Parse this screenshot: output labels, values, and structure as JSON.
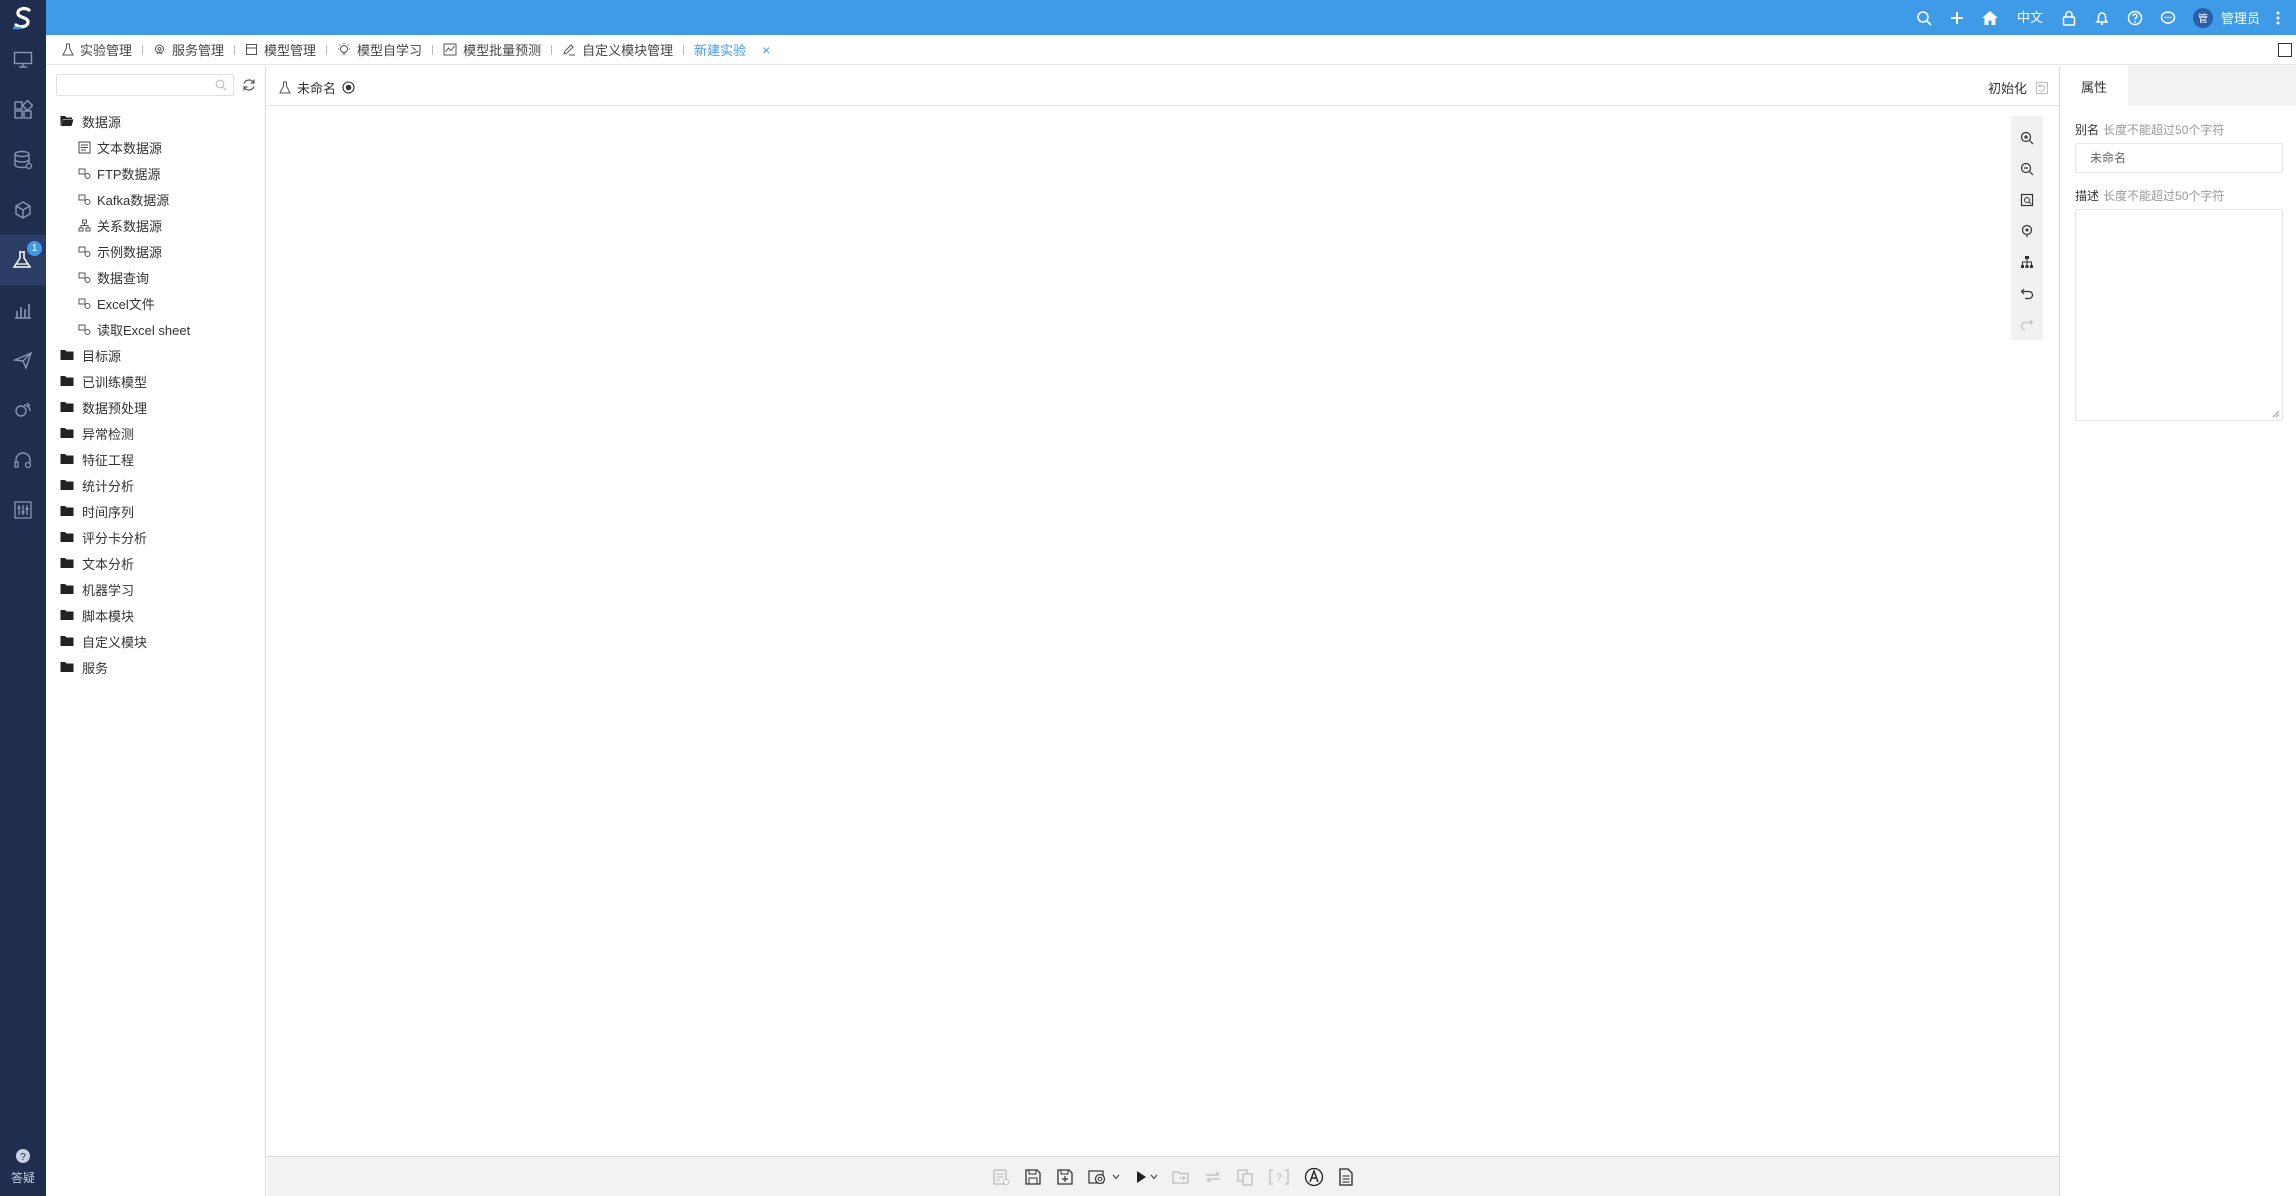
{
  "header": {
    "language": "中文",
    "user_name": "管理员",
    "avatar_text": "管"
  },
  "nav": {
    "badge": "1",
    "help_label": "答疑"
  },
  "tabs": [
    {
      "label": "实验管理"
    },
    {
      "label": "服务管理"
    },
    {
      "label": "模型管理"
    },
    {
      "label": "模型自学习"
    },
    {
      "label": "模型批量预测"
    },
    {
      "label": "自定义模块管理"
    },
    {
      "label": "新建实验",
      "active": true
    }
  ],
  "tree": {
    "search_placeholder": "",
    "datasource": {
      "label": "数据源",
      "children": [
        "文本数据源",
        "FTP数据源",
        "Kafka数据源",
        "关系数据源",
        "示例数据源",
        "数据查询",
        "Excel文件",
        "读取Excel sheet"
      ]
    },
    "folders": [
      "目标源",
      "已训练模型",
      "数据预处理",
      "异常检测",
      "特征工程",
      "统计分析",
      "时间序列",
      "评分卡分析",
      "文本分析",
      "机器学习",
      "脚本模块",
      "自定义模块",
      "服务"
    ]
  },
  "canvas": {
    "experiment_name": "未命名",
    "init_label": "初始化"
  },
  "properties": {
    "tab_label": "属性",
    "alias_label": "别名",
    "alias_hint": "长度不能超过50个字符",
    "alias_value": "未命名",
    "desc_label": "描述",
    "desc_hint": "长度不能超过50个字符"
  },
  "colors": {
    "topbar": "#3f9ae7",
    "sidebar": "#1f2d4f",
    "active_tab": "#3f9ae7"
  }
}
